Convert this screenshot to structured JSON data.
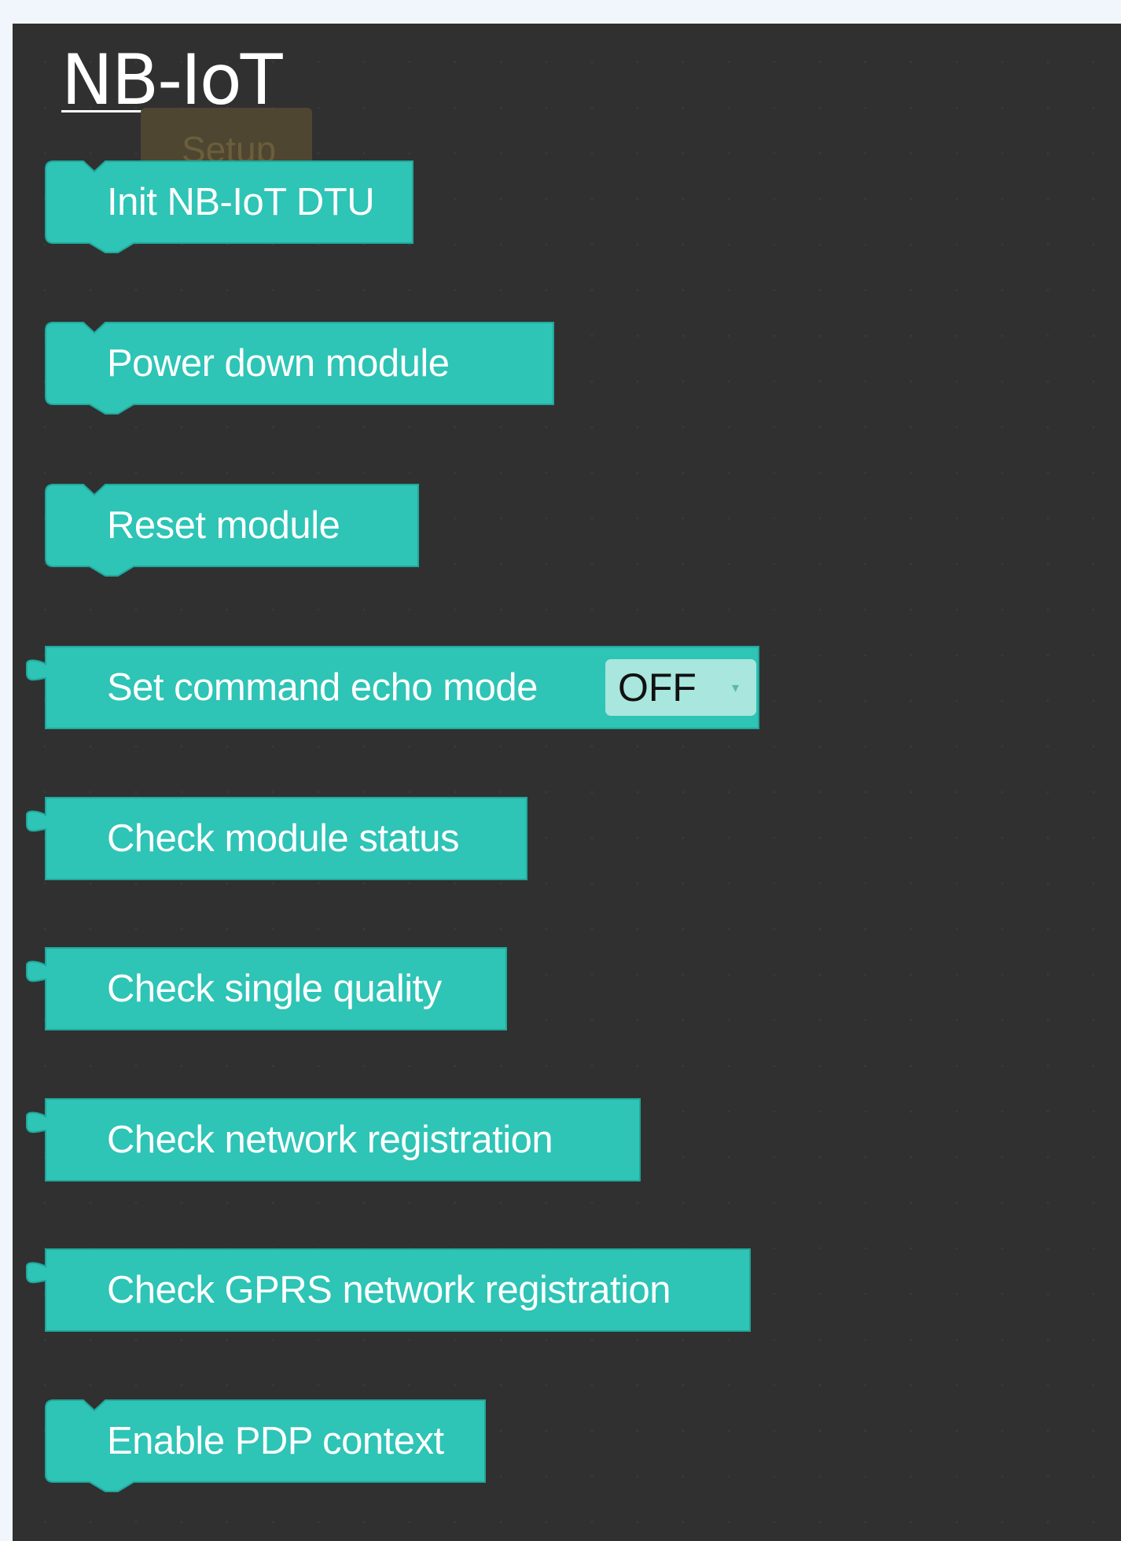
{
  "category": {
    "title": "NB-IoT"
  },
  "ghost_block": {
    "label": "Setup"
  },
  "colors": {
    "block": "#2ec4b6",
    "block_border": "#21a89b",
    "workspace": "#303030",
    "dropdown_bg": "#a8e6de"
  },
  "blocks": [
    {
      "label": "Init NB-IoT DTU",
      "shape": "statement"
    },
    {
      "label": "Power down module",
      "shape": "statement"
    },
    {
      "label": "Reset module",
      "shape": "statement"
    },
    {
      "label": "Set command echo mode",
      "shape": "value",
      "dropdown": {
        "value": "OFF",
        "arrow": "▾"
      }
    },
    {
      "label": "Check module status",
      "shape": "value"
    },
    {
      "label": "Check single quality",
      "shape": "value"
    },
    {
      "label": "Check network registration",
      "shape": "value"
    },
    {
      "label": "Check GPRS network registration",
      "shape": "value"
    },
    {
      "label": "Enable PDP context",
      "shape": "statement"
    }
  ]
}
